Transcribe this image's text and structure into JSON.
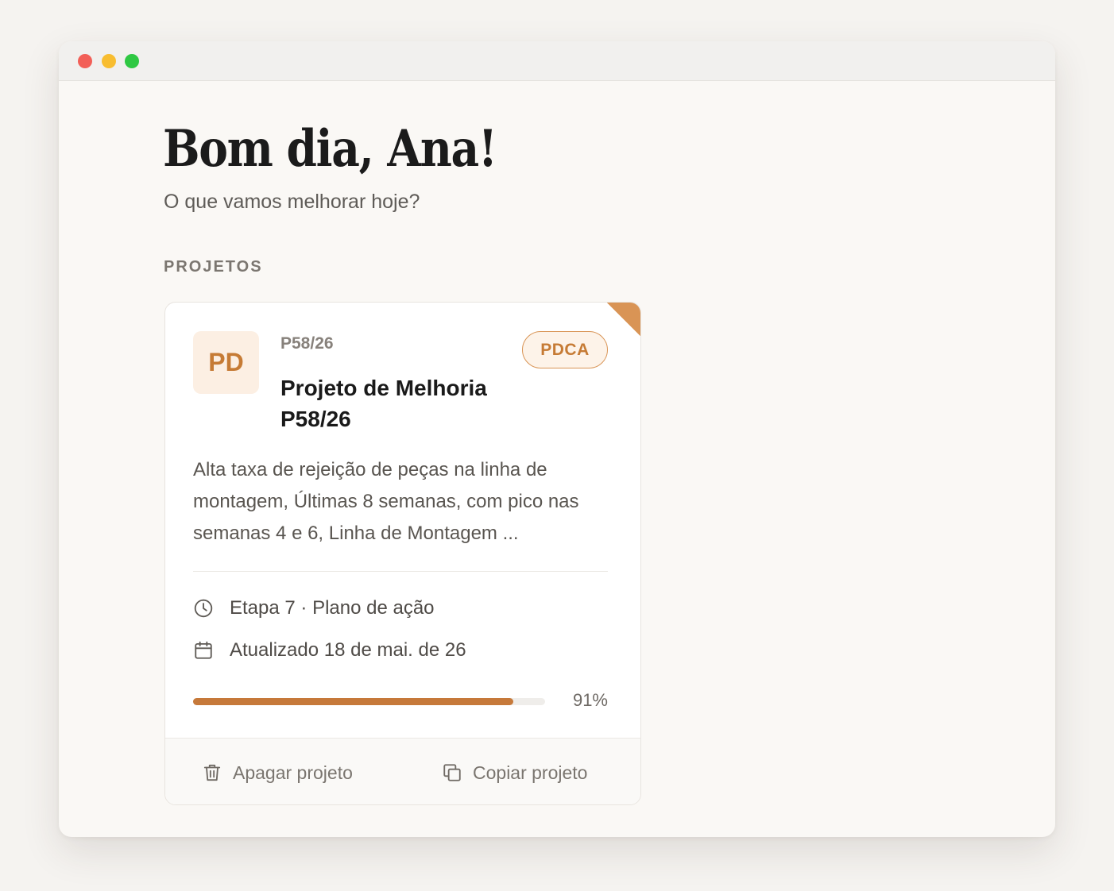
{
  "window": {
    "controls": [
      "close",
      "minimize",
      "maximize"
    ]
  },
  "header": {
    "greeting": "Bom dia, Ana!",
    "subtitle": "O que vamos melhorar hoje?"
  },
  "projects": {
    "section_label": "PROJETOS",
    "items": [
      {
        "avatar_text": "PD",
        "code": "P58/26",
        "methodology": "PDCA",
        "title": "Projeto de Melhoria P58/26",
        "description": "Alta taxa de rejeição de peças na linha de montagem, Últimas 8 semanas, com pico nas semanas 4 e 6, Linha de Montagem ...",
        "step": "Etapa 7 · Plano de ação",
        "updated": "Atualizado 18 de mai. de 26",
        "progress": 91,
        "progress_label": "91%",
        "actions": {
          "delete_label": "Apagar projeto",
          "copy_label": "Copiar projeto"
        }
      }
    ]
  },
  "colors": {
    "accent": "#c6793a",
    "badge_border": "#d99455",
    "avatar_bg": "#fcefe3",
    "background": "#faf8f5"
  },
  "icons": {
    "step": "clock-icon",
    "updated": "calendar-icon",
    "delete": "trash-icon",
    "copy": "copy-icon"
  }
}
